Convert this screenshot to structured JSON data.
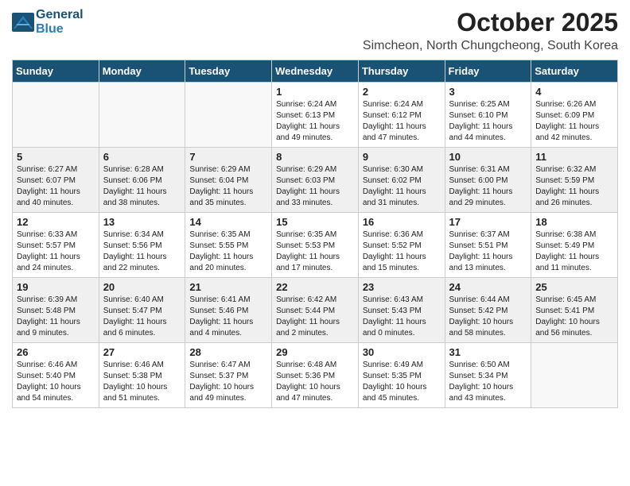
{
  "header": {
    "logo_line1": "General",
    "logo_line2": "Blue",
    "month": "October 2025",
    "location": "Simcheon, North Chungcheong, South Korea"
  },
  "weekdays": [
    "Sunday",
    "Monday",
    "Tuesday",
    "Wednesday",
    "Thursday",
    "Friday",
    "Saturday"
  ],
  "weeks": [
    [
      {
        "day": "",
        "text": ""
      },
      {
        "day": "",
        "text": ""
      },
      {
        "day": "",
        "text": ""
      },
      {
        "day": "1",
        "text": "Sunrise: 6:24 AM\nSunset: 6:13 PM\nDaylight: 11 hours\nand 49 minutes."
      },
      {
        "day": "2",
        "text": "Sunrise: 6:24 AM\nSunset: 6:12 PM\nDaylight: 11 hours\nand 47 minutes."
      },
      {
        "day": "3",
        "text": "Sunrise: 6:25 AM\nSunset: 6:10 PM\nDaylight: 11 hours\nand 44 minutes."
      },
      {
        "day": "4",
        "text": "Sunrise: 6:26 AM\nSunset: 6:09 PM\nDaylight: 11 hours\nand 42 minutes."
      }
    ],
    [
      {
        "day": "5",
        "text": "Sunrise: 6:27 AM\nSunset: 6:07 PM\nDaylight: 11 hours\nand 40 minutes."
      },
      {
        "day": "6",
        "text": "Sunrise: 6:28 AM\nSunset: 6:06 PM\nDaylight: 11 hours\nand 38 minutes."
      },
      {
        "day": "7",
        "text": "Sunrise: 6:29 AM\nSunset: 6:04 PM\nDaylight: 11 hours\nand 35 minutes."
      },
      {
        "day": "8",
        "text": "Sunrise: 6:29 AM\nSunset: 6:03 PM\nDaylight: 11 hours\nand 33 minutes."
      },
      {
        "day": "9",
        "text": "Sunrise: 6:30 AM\nSunset: 6:02 PM\nDaylight: 11 hours\nand 31 minutes."
      },
      {
        "day": "10",
        "text": "Sunrise: 6:31 AM\nSunset: 6:00 PM\nDaylight: 11 hours\nand 29 minutes."
      },
      {
        "day": "11",
        "text": "Sunrise: 6:32 AM\nSunset: 5:59 PM\nDaylight: 11 hours\nand 26 minutes."
      }
    ],
    [
      {
        "day": "12",
        "text": "Sunrise: 6:33 AM\nSunset: 5:57 PM\nDaylight: 11 hours\nand 24 minutes."
      },
      {
        "day": "13",
        "text": "Sunrise: 6:34 AM\nSunset: 5:56 PM\nDaylight: 11 hours\nand 22 minutes."
      },
      {
        "day": "14",
        "text": "Sunrise: 6:35 AM\nSunset: 5:55 PM\nDaylight: 11 hours\nand 20 minutes."
      },
      {
        "day": "15",
        "text": "Sunrise: 6:35 AM\nSunset: 5:53 PM\nDaylight: 11 hours\nand 17 minutes."
      },
      {
        "day": "16",
        "text": "Sunrise: 6:36 AM\nSunset: 5:52 PM\nDaylight: 11 hours\nand 15 minutes."
      },
      {
        "day": "17",
        "text": "Sunrise: 6:37 AM\nSunset: 5:51 PM\nDaylight: 11 hours\nand 13 minutes."
      },
      {
        "day": "18",
        "text": "Sunrise: 6:38 AM\nSunset: 5:49 PM\nDaylight: 11 hours\nand 11 minutes."
      }
    ],
    [
      {
        "day": "19",
        "text": "Sunrise: 6:39 AM\nSunset: 5:48 PM\nDaylight: 11 hours\nand 9 minutes."
      },
      {
        "day": "20",
        "text": "Sunrise: 6:40 AM\nSunset: 5:47 PM\nDaylight: 11 hours\nand 6 minutes."
      },
      {
        "day": "21",
        "text": "Sunrise: 6:41 AM\nSunset: 5:46 PM\nDaylight: 11 hours\nand 4 minutes."
      },
      {
        "day": "22",
        "text": "Sunrise: 6:42 AM\nSunset: 5:44 PM\nDaylight: 11 hours\nand 2 minutes."
      },
      {
        "day": "23",
        "text": "Sunrise: 6:43 AM\nSunset: 5:43 PM\nDaylight: 11 hours\nand 0 minutes."
      },
      {
        "day": "24",
        "text": "Sunrise: 6:44 AM\nSunset: 5:42 PM\nDaylight: 10 hours\nand 58 minutes."
      },
      {
        "day": "25",
        "text": "Sunrise: 6:45 AM\nSunset: 5:41 PM\nDaylight: 10 hours\nand 56 minutes."
      }
    ],
    [
      {
        "day": "26",
        "text": "Sunrise: 6:46 AM\nSunset: 5:40 PM\nDaylight: 10 hours\nand 54 minutes."
      },
      {
        "day": "27",
        "text": "Sunrise: 6:46 AM\nSunset: 5:38 PM\nDaylight: 10 hours\nand 51 minutes."
      },
      {
        "day": "28",
        "text": "Sunrise: 6:47 AM\nSunset: 5:37 PM\nDaylight: 10 hours\nand 49 minutes."
      },
      {
        "day": "29",
        "text": "Sunrise: 6:48 AM\nSunset: 5:36 PM\nDaylight: 10 hours\nand 47 minutes."
      },
      {
        "day": "30",
        "text": "Sunrise: 6:49 AM\nSunset: 5:35 PM\nDaylight: 10 hours\nand 45 minutes."
      },
      {
        "day": "31",
        "text": "Sunrise: 6:50 AM\nSunset: 5:34 PM\nDaylight: 10 hours\nand 43 minutes."
      },
      {
        "day": "",
        "text": ""
      }
    ]
  ]
}
